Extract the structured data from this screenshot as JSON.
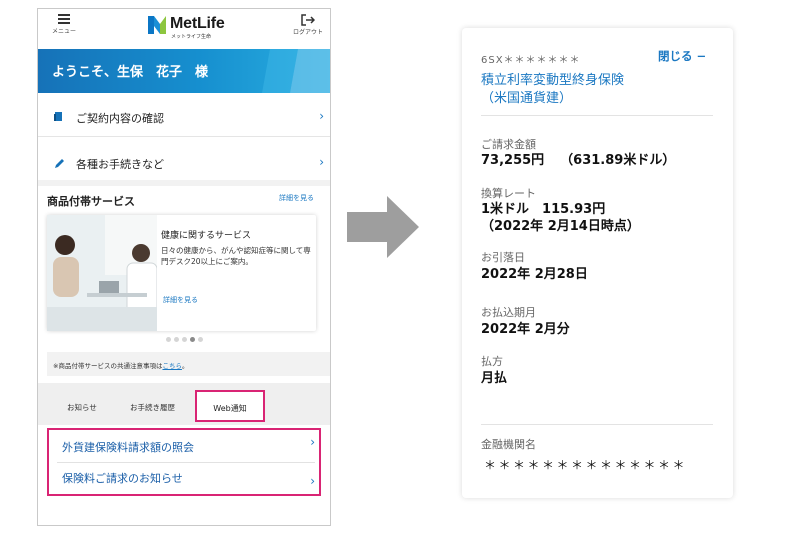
{
  "header": {
    "menu_label": "メニュー",
    "logo_text": "MetLife",
    "logo_sub": "メットライフ生命",
    "logout_label": "ログアウト"
  },
  "welcome": {
    "text": "ようこそ、生保　花子　様"
  },
  "menu_rows": [
    {
      "label": "ご契約内容の確認",
      "icon": "document-icon"
    },
    {
      "label": "各種お手続きなど",
      "icon": "pencil-icon"
    }
  ],
  "services": {
    "title": "商品付帯サービス",
    "more": "詳細を見る",
    "card": {
      "title": "健康に関するサービス",
      "body": "日々の健康から、がんや認知症等に関して専門デスク20以上にご案内。",
      "more": "詳細を見る"
    },
    "carousel": {
      "count": 5,
      "active_index": 3
    },
    "note_prefix": "※商品付帯サービスの共通注意事項は",
    "note_link": "こちら",
    "note_suffix": "。"
  },
  "tabs": [
    {
      "label": "お知らせ",
      "selected": false
    },
    {
      "label": "お手続き履歴",
      "selected": false
    },
    {
      "label": "Web通知",
      "selected": true
    }
  ],
  "notifications": [
    {
      "label": "外貨建保険料請求額の照会"
    },
    {
      "label": "保険料ご請求のお知らせ"
    }
  ],
  "detail": {
    "policy_id": "6SX＊＊＊＊＊＊＊",
    "close_label": "閉じる −",
    "product_line1": "積立利率変動型終身保険",
    "product_line2": "（米国通貨建）",
    "amount_label": "ご請求金額",
    "amount_jpy": "73,255円",
    "amount_usd": "（631.89米ドル）",
    "rate_label": "換算レート",
    "rate_value": "1米ドル　115.93円",
    "rate_date": "（2022年 2月14日時点）",
    "debit_label": "お引落日",
    "debit_value": "2022年 2月28日",
    "month_label": "お払込期月",
    "month_value": "2022年 2月分",
    "method_label": "払方",
    "method_value": "月払",
    "bank_label": "金融機関名",
    "bank_value": "＊＊＊＊＊＊＊＊＊＊＊＊＊＊"
  },
  "colors": {
    "brand_blue": "#1672b8",
    "link_blue": "#1b78c2",
    "highlight_pink": "#d92474",
    "logo_green": "#8dc63f"
  }
}
